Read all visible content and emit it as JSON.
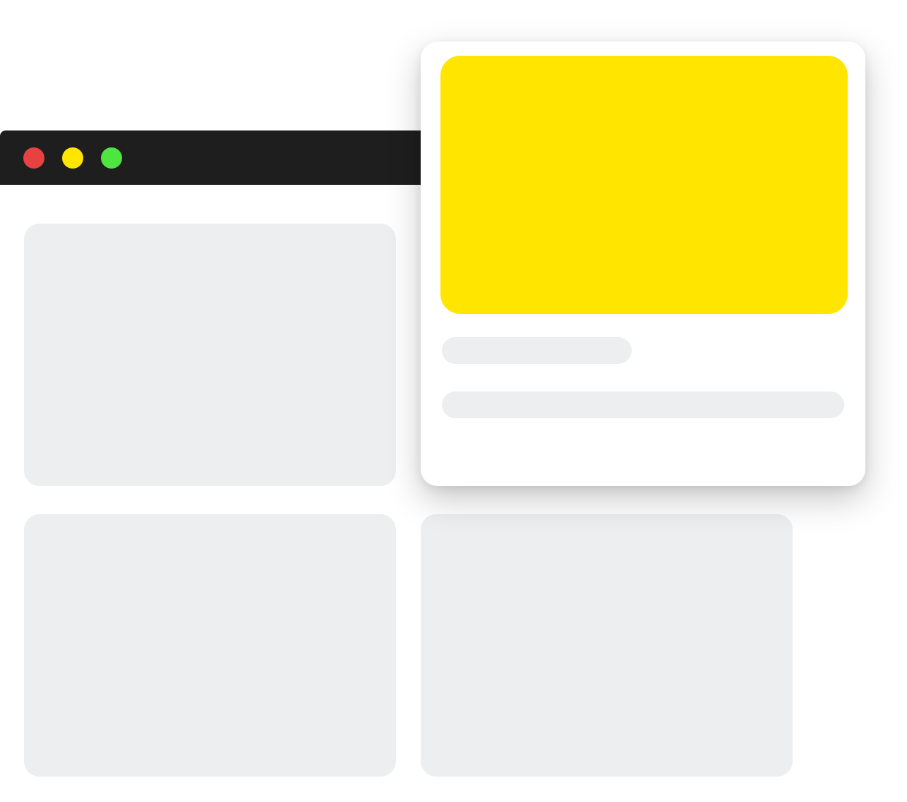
{
  "window": {
    "controls": [
      {
        "name": "close-button",
        "color": "#e84142"
      },
      {
        "name": "minimize-button",
        "color": "#ffe500"
      },
      {
        "name": "maximize-button",
        "color": "#4ee540"
      }
    ],
    "titlebar_color": "#1e1e1e"
  },
  "content": {
    "placeholder_color": "#edeef0",
    "cards": [
      "placeholder-card",
      "placeholder-card",
      "placeholder-card"
    ]
  },
  "floating_card": {
    "hero_color": "#ffe500",
    "text_lines": [
      "",
      ""
    ]
  }
}
